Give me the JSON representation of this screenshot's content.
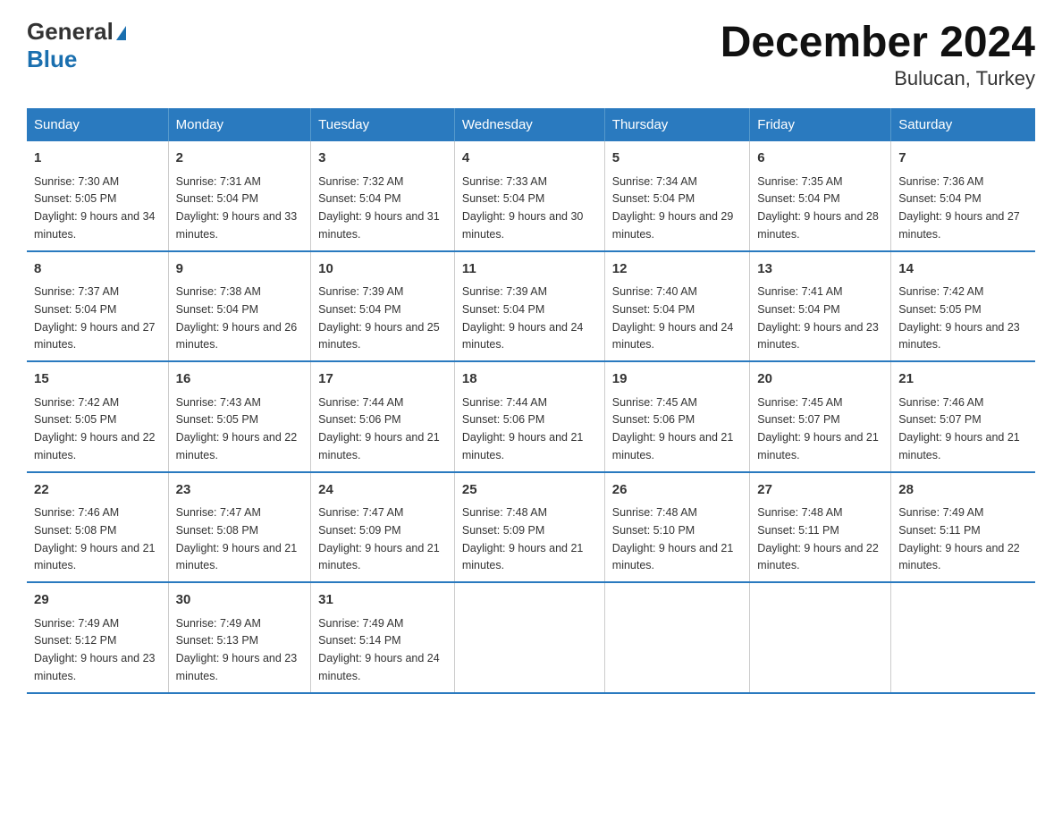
{
  "header": {
    "logo_general": "General",
    "logo_blue": "Blue",
    "title": "December 2024",
    "subtitle": "Bulucan, Turkey"
  },
  "days_of_week": [
    "Sunday",
    "Monday",
    "Tuesday",
    "Wednesday",
    "Thursday",
    "Friday",
    "Saturday"
  ],
  "weeks": [
    [
      {
        "day": "1",
        "sunrise": "Sunrise: 7:30 AM",
        "sunset": "Sunset: 5:05 PM",
        "daylight": "Daylight: 9 hours and 34 minutes."
      },
      {
        "day": "2",
        "sunrise": "Sunrise: 7:31 AM",
        "sunset": "Sunset: 5:04 PM",
        "daylight": "Daylight: 9 hours and 33 minutes."
      },
      {
        "day": "3",
        "sunrise": "Sunrise: 7:32 AM",
        "sunset": "Sunset: 5:04 PM",
        "daylight": "Daylight: 9 hours and 31 minutes."
      },
      {
        "day": "4",
        "sunrise": "Sunrise: 7:33 AM",
        "sunset": "Sunset: 5:04 PM",
        "daylight": "Daylight: 9 hours and 30 minutes."
      },
      {
        "day": "5",
        "sunrise": "Sunrise: 7:34 AM",
        "sunset": "Sunset: 5:04 PM",
        "daylight": "Daylight: 9 hours and 29 minutes."
      },
      {
        "day": "6",
        "sunrise": "Sunrise: 7:35 AM",
        "sunset": "Sunset: 5:04 PM",
        "daylight": "Daylight: 9 hours and 28 minutes."
      },
      {
        "day": "7",
        "sunrise": "Sunrise: 7:36 AM",
        "sunset": "Sunset: 5:04 PM",
        "daylight": "Daylight: 9 hours and 27 minutes."
      }
    ],
    [
      {
        "day": "8",
        "sunrise": "Sunrise: 7:37 AM",
        "sunset": "Sunset: 5:04 PM",
        "daylight": "Daylight: 9 hours and 27 minutes."
      },
      {
        "day": "9",
        "sunrise": "Sunrise: 7:38 AM",
        "sunset": "Sunset: 5:04 PM",
        "daylight": "Daylight: 9 hours and 26 minutes."
      },
      {
        "day": "10",
        "sunrise": "Sunrise: 7:39 AM",
        "sunset": "Sunset: 5:04 PM",
        "daylight": "Daylight: 9 hours and 25 minutes."
      },
      {
        "day": "11",
        "sunrise": "Sunrise: 7:39 AM",
        "sunset": "Sunset: 5:04 PM",
        "daylight": "Daylight: 9 hours and 24 minutes."
      },
      {
        "day": "12",
        "sunrise": "Sunrise: 7:40 AM",
        "sunset": "Sunset: 5:04 PM",
        "daylight": "Daylight: 9 hours and 24 minutes."
      },
      {
        "day": "13",
        "sunrise": "Sunrise: 7:41 AM",
        "sunset": "Sunset: 5:04 PM",
        "daylight": "Daylight: 9 hours and 23 minutes."
      },
      {
        "day": "14",
        "sunrise": "Sunrise: 7:42 AM",
        "sunset": "Sunset: 5:05 PM",
        "daylight": "Daylight: 9 hours and 23 minutes."
      }
    ],
    [
      {
        "day": "15",
        "sunrise": "Sunrise: 7:42 AM",
        "sunset": "Sunset: 5:05 PM",
        "daylight": "Daylight: 9 hours and 22 minutes."
      },
      {
        "day": "16",
        "sunrise": "Sunrise: 7:43 AM",
        "sunset": "Sunset: 5:05 PM",
        "daylight": "Daylight: 9 hours and 22 minutes."
      },
      {
        "day": "17",
        "sunrise": "Sunrise: 7:44 AM",
        "sunset": "Sunset: 5:06 PM",
        "daylight": "Daylight: 9 hours and 21 minutes."
      },
      {
        "day": "18",
        "sunrise": "Sunrise: 7:44 AM",
        "sunset": "Sunset: 5:06 PM",
        "daylight": "Daylight: 9 hours and 21 minutes."
      },
      {
        "day": "19",
        "sunrise": "Sunrise: 7:45 AM",
        "sunset": "Sunset: 5:06 PM",
        "daylight": "Daylight: 9 hours and 21 minutes."
      },
      {
        "day": "20",
        "sunrise": "Sunrise: 7:45 AM",
        "sunset": "Sunset: 5:07 PM",
        "daylight": "Daylight: 9 hours and 21 minutes."
      },
      {
        "day": "21",
        "sunrise": "Sunrise: 7:46 AM",
        "sunset": "Sunset: 5:07 PM",
        "daylight": "Daylight: 9 hours and 21 minutes."
      }
    ],
    [
      {
        "day": "22",
        "sunrise": "Sunrise: 7:46 AM",
        "sunset": "Sunset: 5:08 PM",
        "daylight": "Daylight: 9 hours and 21 minutes."
      },
      {
        "day": "23",
        "sunrise": "Sunrise: 7:47 AM",
        "sunset": "Sunset: 5:08 PM",
        "daylight": "Daylight: 9 hours and 21 minutes."
      },
      {
        "day": "24",
        "sunrise": "Sunrise: 7:47 AM",
        "sunset": "Sunset: 5:09 PM",
        "daylight": "Daylight: 9 hours and 21 minutes."
      },
      {
        "day": "25",
        "sunrise": "Sunrise: 7:48 AM",
        "sunset": "Sunset: 5:09 PM",
        "daylight": "Daylight: 9 hours and 21 minutes."
      },
      {
        "day": "26",
        "sunrise": "Sunrise: 7:48 AM",
        "sunset": "Sunset: 5:10 PM",
        "daylight": "Daylight: 9 hours and 21 minutes."
      },
      {
        "day": "27",
        "sunrise": "Sunrise: 7:48 AM",
        "sunset": "Sunset: 5:11 PM",
        "daylight": "Daylight: 9 hours and 22 minutes."
      },
      {
        "day": "28",
        "sunrise": "Sunrise: 7:49 AM",
        "sunset": "Sunset: 5:11 PM",
        "daylight": "Daylight: 9 hours and 22 minutes."
      }
    ],
    [
      {
        "day": "29",
        "sunrise": "Sunrise: 7:49 AM",
        "sunset": "Sunset: 5:12 PM",
        "daylight": "Daylight: 9 hours and 23 minutes."
      },
      {
        "day": "30",
        "sunrise": "Sunrise: 7:49 AM",
        "sunset": "Sunset: 5:13 PM",
        "daylight": "Daylight: 9 hours and 23 minutes."
      },
      {
        "day": "31",
        "sunrise": "Sunrise: 7:49 AM",
        "sunset": "Sunset: 5:14 PM",
        "daylight": "Daylight: 9 hours and 24 minutes."
      },
      {
        "day": "",
        "sunrise": "",
        "sunset": "",
        "daylight": ""
      },
      {
        "day": "",
        "sunrise": "",
        "sunset": "",
        "daylight": ""
      },
      {
        "day": "",
        "sunrise": "",
        "sunset": "",
        "daylight": ""
      },
      {
        "day": "",
        "sunrise": "",
        "sunset": "",
        "daylight": ""
      }
    ]
  ]
}
